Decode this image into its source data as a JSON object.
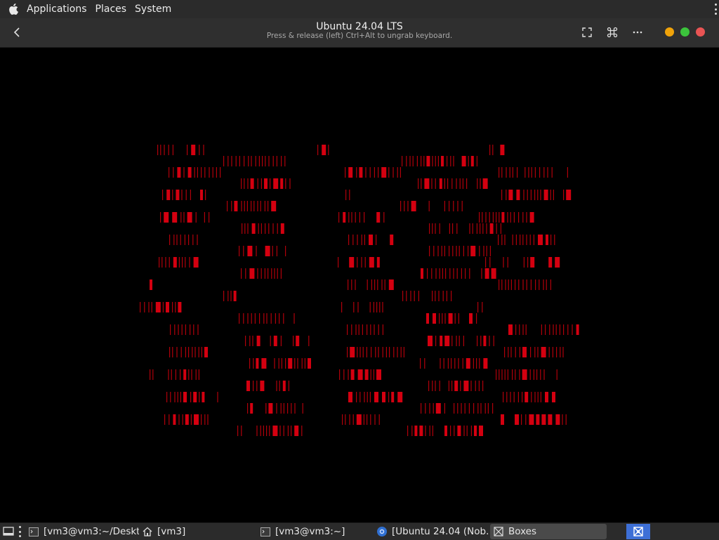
{
  "top_panel": {
    "menus": [
      "Applications",
      "Places",
      "System"
    ]
  },
  "header": {
    "title": "Ubuntu 24.04 LTS",
    "subtitle": "Press & release (left) Ctrl+Alt to ungrab keyboard.",
    "icons": {
      "back": "chevron-left-icon",
      "fullscreen": "fullscreen-icon",
      "keys": "command-key-icon",
      "menu": "more-horizontal-icon"
    },
    "window_controls": {
      "minimize_color": "#f0a30a",
      "maximize_color": "#3cc43c",
      "close_color": "#e95454"
    }
  },
  "vm_display": {
    "background": "#000000",
    "glyph_color": "#b0000a",
    "glyph_bright": "#d40010"
  },
  "taskbar": {
    "tasks": [
      {
        "label": "[vm3@vm3:~/Deskt...",
        "icon": "terminal-icon"
      },
      {
        "label": "[vm3]",
        "icon": "home-icon"
      },
      {
        "label": "[vm3@vm3:~]",
        "icon": "terminal-icon"
      },
      {
        "label": "[Ubuntu 24.04 (Nob...",
        "icon": "browser-icon"
      },
      {
        "label": "Boxes",
        "icon": "boxes-icon"
      }
    ],
    "accent": "#3d6fd6"
  }
}
